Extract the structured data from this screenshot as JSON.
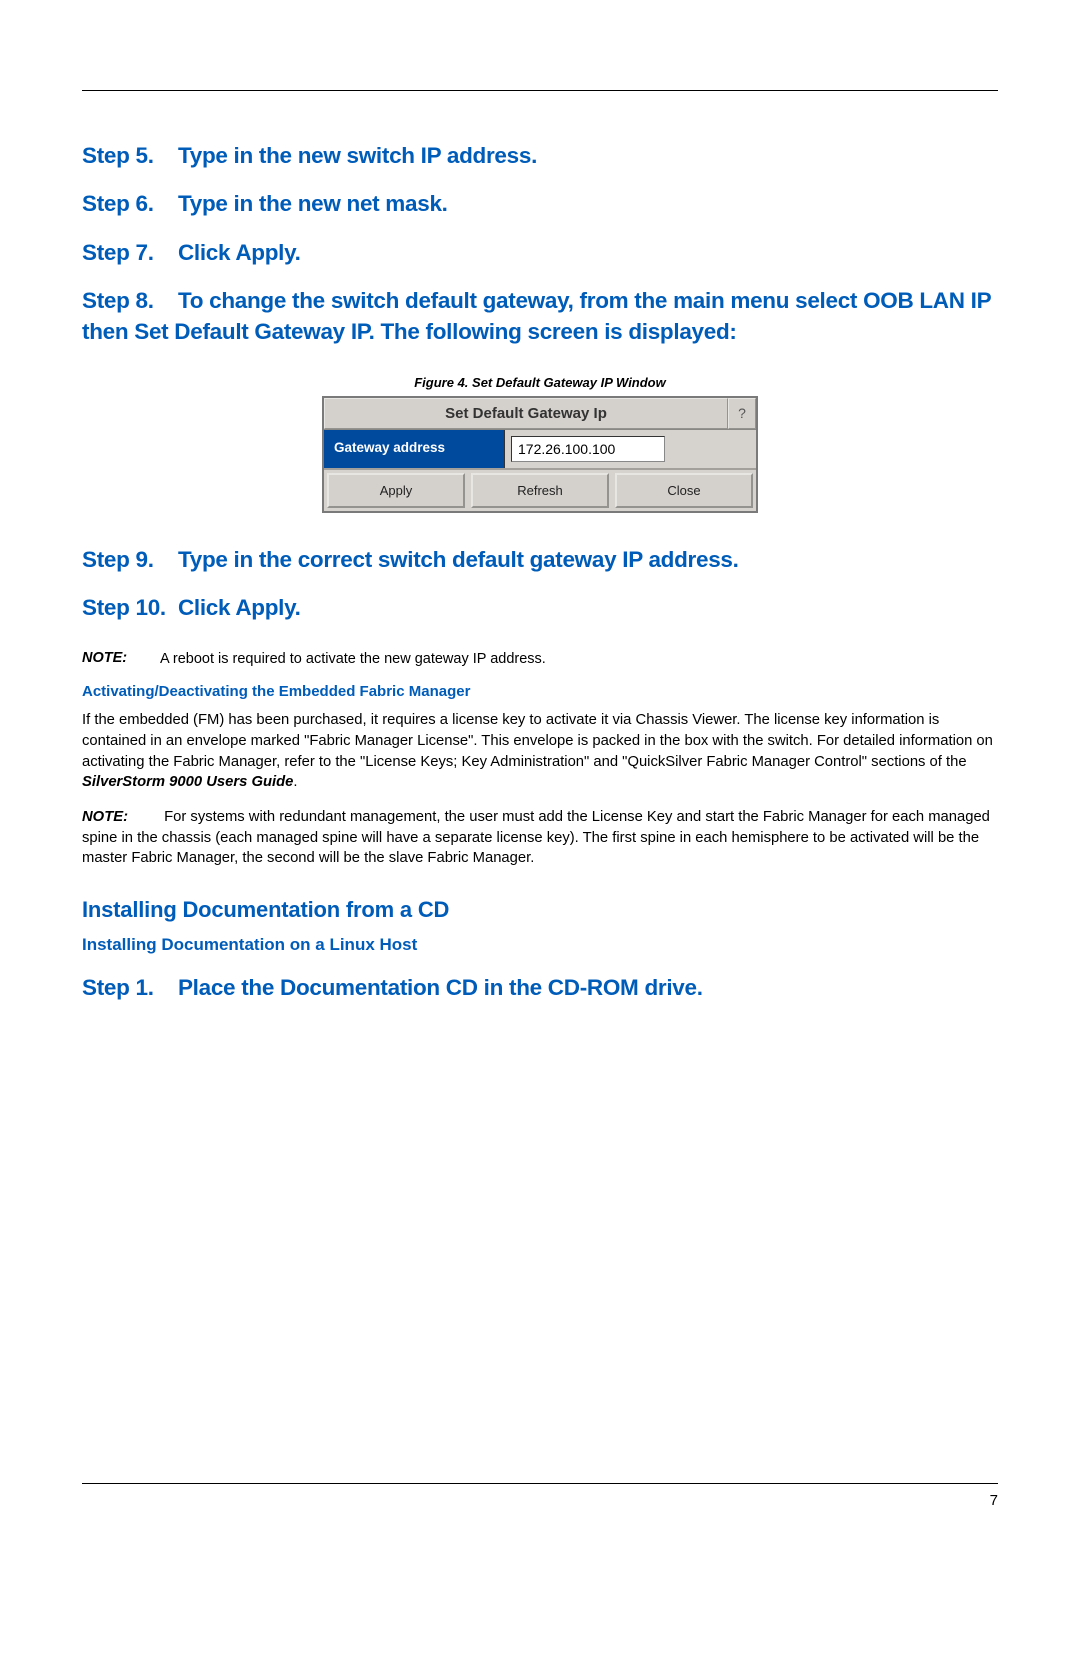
{
  "steps": {
    "step5": {
      "label": "Step 5.",
      "text": "Type in the new switch IP address."
    },
    "step6": {
      "label": "Step 6.",
      "text": "Type in the new net mask."
    },
    "step7": {
      "label": "Step 7.",
      "text": "Click Apply."
    },
    "step8": {
      "label": "Step 8.",
      "text": "To change the switch default gateway, from the main menu select OOB LAN IP then Set Default Gateway IP. The following screen is displayed:"
    },
    "step9": {
      "label": "Step 9.",
      "text": "Type in the correct switch default gateway IP address."
    },
    "step10": {
      "label": "Step 10.",
      "text": "Click Apply."
    },
    "cd_step1": {
      "label": "Step 1.",
      "text": "Place the Documentation CD in the CD-ROM drive."
    }
  },
  "figure": {
    "caption": "Figure 4. Set Default Gateway IP Window"
  },
  "dialog": {
    "title": "Set Default Gateway Ip",
    "help": "?",
    "gateway_label": "Gateway address",
    "gateway_value": "172.26.100.100",
    "apply": "Apply",
    "refresh": "Refresh",
    "close": "Close"
  },
  "notes": {
    "note1_label": "NOTE:",
    "note1_text": "A reboot is required to activate the new gateway IP address.",
    "note2_label": "NOTE:",
    "note2_text": "For systems with redundant management, the user must add the License Key and start the Fabric Manager for each managed spine in the chassis (each managed spine will have a separate license key). The first spine in each hemisphere to be activated will be the master Fabric Manager, the second will be the slave Fabric Manager."
  },
  "subheads": {
    "fm_activate": "Activating/Deactivating the Embedded Fabric Manager",
    "install_cd": "Installing Documentation from a CD",
    "install_linux": "Installing Documentation on a Linux Host"
  },
  "paragraphs": {
    "fm_para_pre": "If the embedded  (FM) has been purchased, it requires a license key to activate it via Chassis Viewer. The license key information is contained in an envelope marked \"Fabric Manager License\". This envelope is packed in the box with the switch. For detailed information on activating the Fabric Manager, refer to the \"License Keys; Key Administration\" and \"QuickSilver Fabric Manager Control\" sections of the ",
    "fm_para_em": "SilverStorm 9000 Users Guide",
    "fm_para_post": "."
  },
  "page_number": "7"
}
